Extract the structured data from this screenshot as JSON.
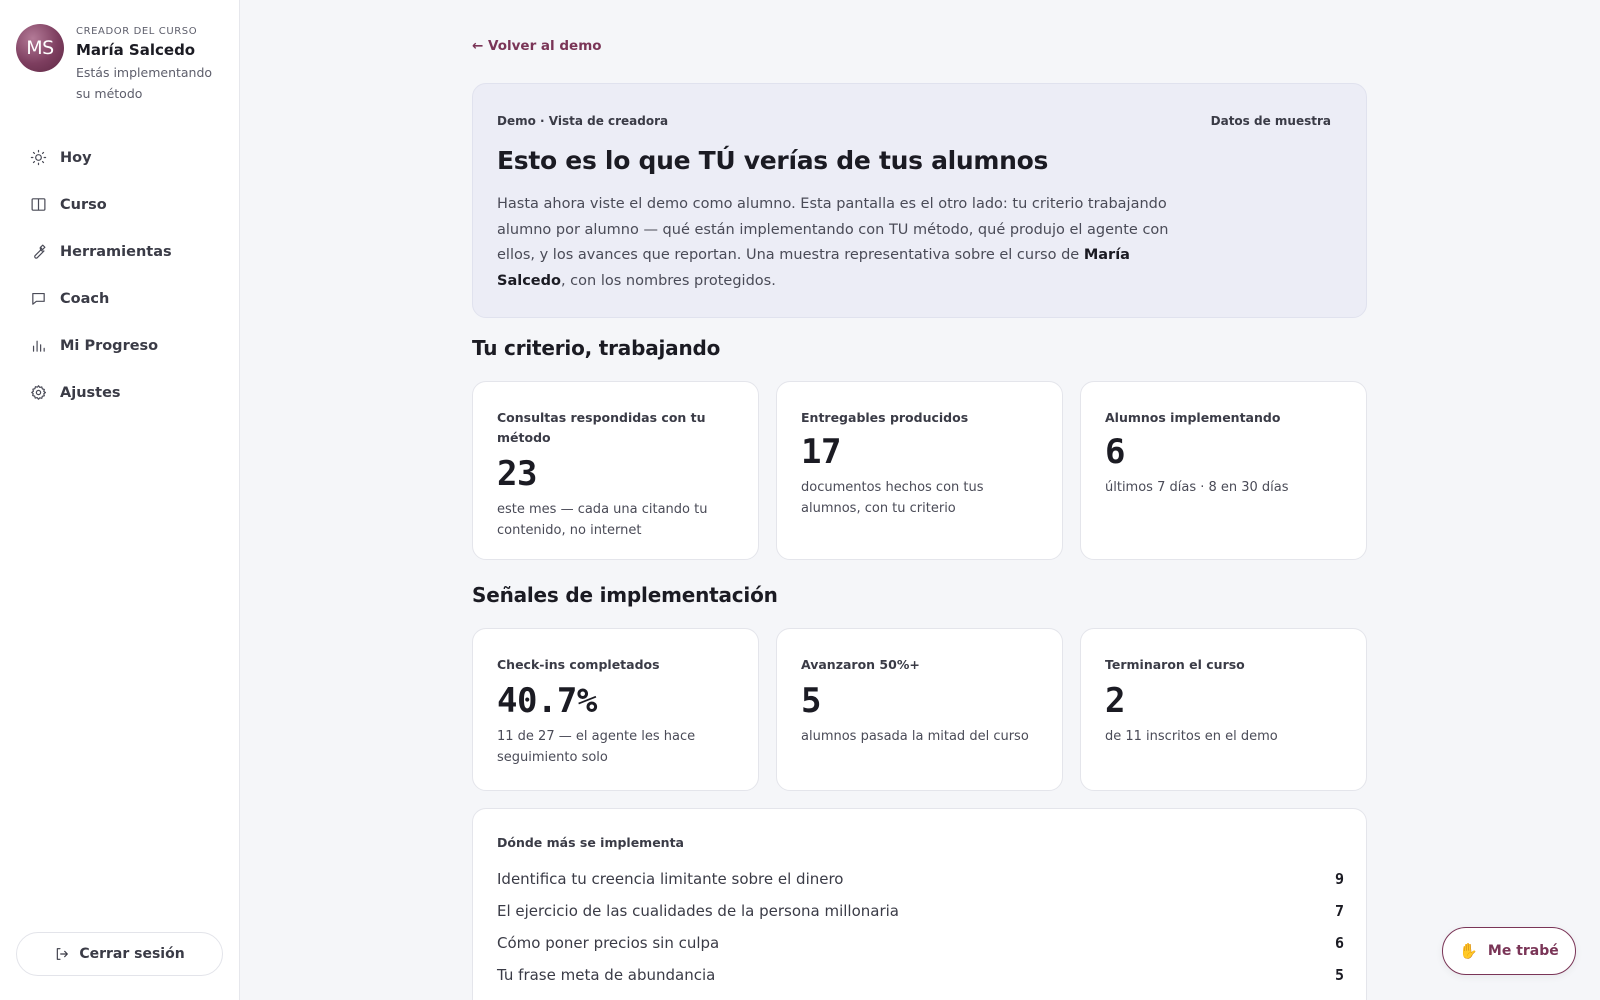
{
  "sidebar": {
    "creator": {
      "initials": "MS",
      "kicker": "CREADOR DEL CURSO",
      "name": "María Salcedo",
      "subtitle": "Estás implementando su método"
    },
    "nav": [
      {
        "label": "Hoy",
        "icon": "sun-icon"
      },
      {
        "label": "Curso",
        "icon": "book-icon"
      },
      {
        "label": "Herramientas",
        "icon": "wrench-icon"
      },
      {
        "label": "Coach",
        "icon": "chat-icon"
      },
      {
        "label": "Mi Progreso",
        "icon": "bar-chart-icon"
      },
      {
        "label": "Ajustes",
        "icon": "gear-icon"
      }
    ],
    "logout_label": "Cerrar sesión"
  },
  "main": {
    "back_label": "← Volver al demo",
    "hero": {
      "kicker": "Demo · Vista de creadora",
      "tag": "Datos de muestra",
      "title": "Esto es lo que TÚ verías de tus alumnos",
      "body_before": "Hasta ahora viste el demo como alumno. Esta pantalla es el otro lado: tu criterio trabajando alumno por alumno — qué están implementando con TU método, qué produjo el agente con ellos, y los avances que reportan. Una muestra representativa sobre el curso de ",
      "body_name": "María Salcedo",
      "body_after": ", con los nombres protegidos."
    },
    "section1_title": "Tu criterio, trabajando",
    "section1_cards": [
      {
        "label": "Consultas respondidas con tu método",
        "value": "23",
        "desc": "este mes — cada una citando tu contenido, no internet"
      },
      {
        "label": "Entregables producidos",
        "value": "17",
        "desc": "documentos hechos con tus alumnos, con tu criterio"
      },
      {
        "label": "Alumnos implementando",
        "value": "6",
        "desc": "últimos 7 días · 8 en 30 días"
      }
    ],
    "section2_title": "Señales de implementación",
    "section2_cards": [
      {
        "label": "Check-ins completados",
        "value": "40.7%",
        "desc": "11 de 27 — el agente les hace seguimiento solo"
      },
      {
        "label": "Avanzaron 50%+",
        "value": "5",
        "desc": "alumnos pasada la mitad del curso"
      },
      {
        "label": "Terminaron el curso",
        "value": "2",
        "desc": "de 11 inscritos en el demo"
      }
    ],
    "top_list": {
      "title": "Dónde más se implementa",
      "rows": [
        {
          "text": "Identifica tu creencia limitante sobre el dinero",
          "count": "9"
        },
        {
          "text": "El ejercicio de las cualidades de la persona millonaria",
          "count": "7"
        },
        {
          "text": "Cómo poner precios sin culpa",
          "count": "6"
        },
        {
          "text": "Tu frase meta de abundancia",
          "count": "5"
        }
      ]
    }
  },
  "help_button": {
    "icon": "hand-icon",
    "label": "Me trabé"
  },
  "colors": {
    "accent": "#7a3557",
    "hero_bg": "#ecedf6",
    "page_bg": "#f5f6f9"
  }
}
